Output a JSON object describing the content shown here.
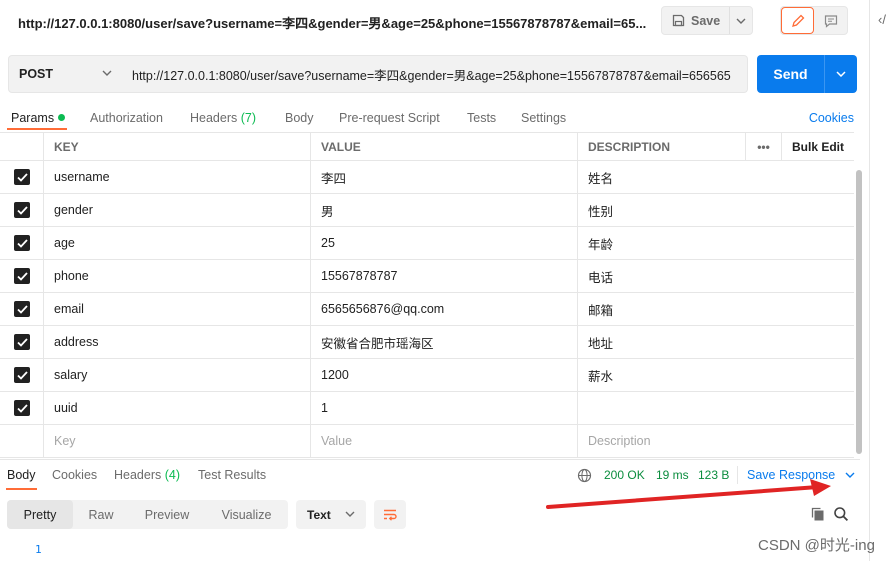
{
  "title_bar": {
    "url_title": "http://127.0.0.1:8080/user/save?username=李四&gender=男&age=25&phone=15567878787&email=65...",
    "save_label": "Save",
    "code_toggle": "‹/"
  },
  "request": {
    "method": "POST",
    "url": "http://127.0.0.1:8080/user/save?username=李四&gender=男&age=25&phone=15567878787&email=656565",
    "send_label": "Send"
  },
  "request_tabs": {
    "params": "Params",
    "authorization": "Authorization",
    "headers": "Headers",
    "headers_count": "(7)",
    "body": "Body",
    "pre_request": "Pre-request Script",
    "tests": "Tests",
    "settings": "Settings",
    "cookies": "Cookies"
  },
  "params_table": {
    "headers": {
      "key": "KEY",
      "value": "VALUE",
      "description": "DESCRIPTION",
      "more": "•••",
      "bulk_edit": "Bulk Edit"
    },
    "rows": [
      {
        "key": "username",
        "value": "李四",
        "description": "姓名"
      },
      {
        "key": "gender",
        "value": "男",
        "description": "性别"
      },
      {
        "key": "age",
        "value": "25",
        "description": "年龄"
      },
      {
        "key": "phone",
        "value": "15567878787",
        "description": "电话"
      },
      {
        "key": "email",
        "value": "6565656876@qq.com",
        "description": "邮箱"
      },
      {
        "key": "address",
        "value": "安徽省合肥市瑶海区",
        "description": "地址"
      },
      {
        "key": "salary",
        "value": "1200",
        "description": "薪水"
      },
      {
        "key": "uuid",
        "value": "1",
        "description": ""
      }
    ],
    "placeholder": {
      "key": "Key",
      "value": "Value",
      "description": "Description"
    }
  },
  "response": {
    "tabs": {
      "body": "Body",
      "cookies": "Cookies",
      "headers": "Headers",
      "headers_count": "(4)",
      "test_results": "Test Results"
    },
    "status": "200 OK",
    "time": "19 ms",
    "size": "123 B",
    "save_response": "Save Response",
    "formats": {
      "pretty": "Pretty",
      "raw": "Raw",
      "preview": "Preview",
      "visualize": "Visualize"
    },
    "language": "Text",
    "line_number": "1"
  },
  "watermark": "CSDN @时光-ing",
  "colors": {
    "accent": "#ff6c37",
    "send": "#097bed",
    "status_ok": "#0b8d3e",
    "arrow": "#e02424"
  }
}
